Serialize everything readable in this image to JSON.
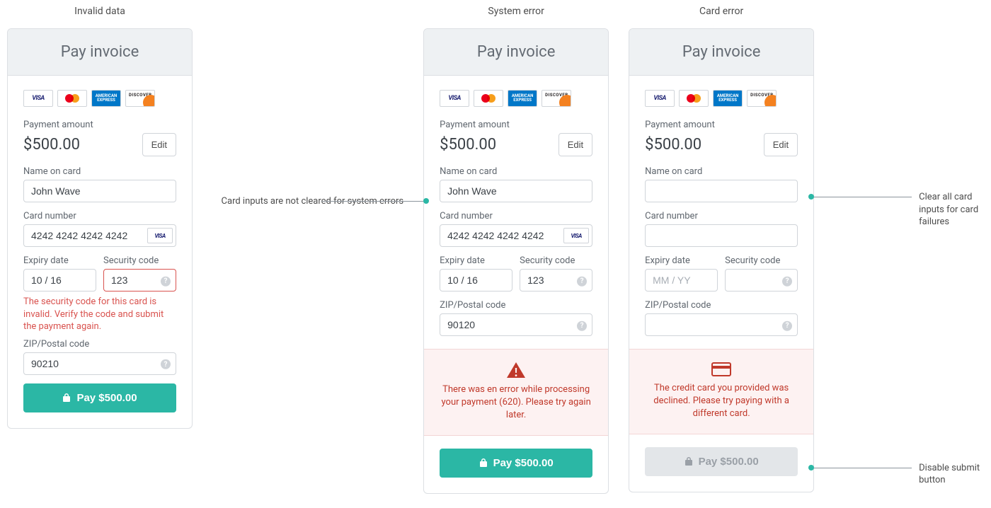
{
  "columns": {
    "invalid": {
      "title": "Invalid data"
    },
    "system": {
      "title": "System error"
    },
    "carderr": {
      "title": "Card error"
    }
  },
  "common": {
    "card_title": "Pay invoice",
    "brands": {
      "visa_label": "VISA",
      "amex_label": "AMERICAN EXPRESS",
      "discover_label": "DISCOVER"
    },
    "labels": {
      "payment_amount": "Payment amount",
      "name_on_card": "Name on card",
      "card_number": "Card number",
      "expiry_date": "Expiry date",
      "security_code": "Security code",
      "zip": "ZIP/Postal code"
    },
    "placeholders": {
      "expiry": "MM / YY"
    },
    "amount_display": "$500.00",
    "edit_label": "Edit",
    "pay_label": "Pay $500.00"
  },
  "panels": {
    "invalid": {
      "name": "John Wave",
      "card_number": "4242 4242 4242 4242",
      "card_brand": "VISA",
      "expiry": "10 / 16",
      "security": "123",
      "zip": "90210",
      "security_error": "The security code for this card is invalid. Verify the code and submit the payment again."
    },
    "system": {
      "name": "John Wave",
      "card_number": "4242 4242 4242 4242",
      "card_brand": "VISA",
      "expiry": "10 / 16",
      "security": "123",
      "zip": "90120",
      "error_message": "There was en error while processing your payment (620). Please try again later."
    },
    "carderr": {
      "name": "",
      "card_number": "",
      "expiry": "",
      "security": "",
      "zip": "",
      "error_message": "The credit card you provided was declined. Please try paying with a different card."
    }
  },
  "annotations": {
    "system_note": "Card inputs are not cleared for system errors",
    "card_clear_note": "Clear all card inputs for card failures",
    "disable_note": "Disable submit button"
  }
}
